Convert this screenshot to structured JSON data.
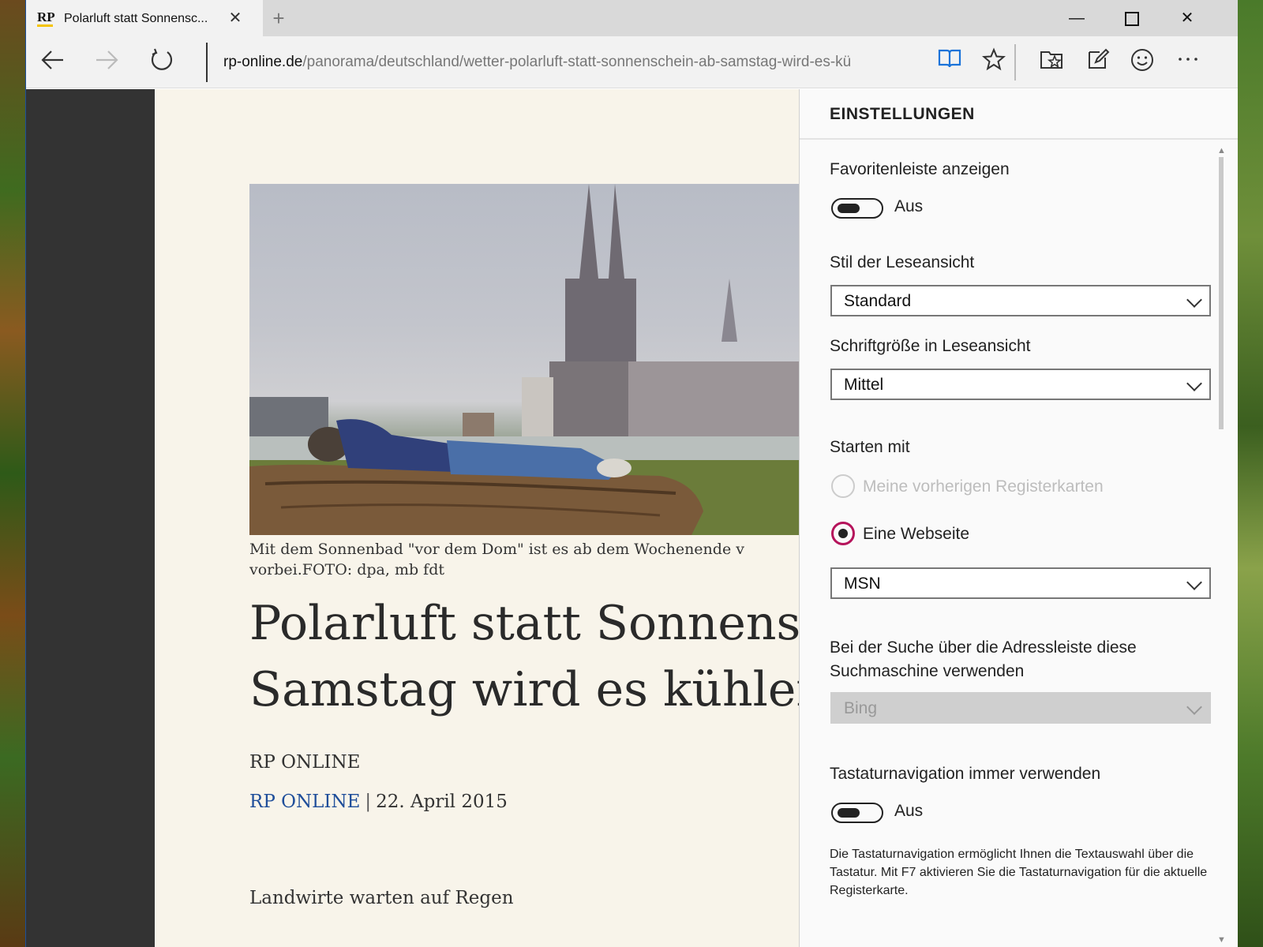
{
  "browser": {
    "tab": {
      "logo": "RP",
      "title": "Polarluft statt Sonnensc...",
      "close_glyph": "✕"
    },
    "new_tab_glyph": "+",
    "window_controls": {
      "minimize": "—",
      "close": "✕"
    },
    "address": {
      "host": "rp-online.de",
      "path": "/panorama/deutschland/wetter-polarluft-statt-sonnenschein-ab-samstag-wird-es-kü"
    },
    "icons": {
      "back": "back-arrow-icon",
      "forward": "forward-arrow-icon",
      "refresh": "refresh-icon",
      "reading_view": "reading-view-icon",
      "favorite": "star-icon",
      "hub": "hub-icon",
      "web_note": "web-note-icon",
      "feedback": "smiley-icon",
      "more": "more-icon"
    },
    "accent_color": "#1a73d9"
  },
  "article": {
    "caption": "Mit dem Sonnenbad \"vor dem Dom\" ist es ab dem Wochenende v",
    "caption_line2": "vorbei.FOTO: dpa, mb fdt",
    "headline_line1": "Polarluft statt Sonnensch",
    "headline_line2": "Samstag wird es kühler",
    "source": "RP ONLINE",
    "byline_link": "RP ONLINE",
    "byline_sep": "|",
    "date": "22. April 2015",
    "subhead": "Landwirte warten auf Regen"
  },
  "settings": {
    "title": "EINSTELLUNGEN",
    "favorites_bar": {
      "label": "Favoritenleiste anzeigen",
      "state": "Aus"
    },
    "reading_style": {
      "label": "Stil der Leseansicht",
      "value": "Standard"
    },
    "reading_font_size": {
      "label": "Schriftgröße in Leseansicht",
      "value": "Mittel"
    },
    "start_with": {
      "label": "Starten mit",
      "option_previous": "Meine vorherigen Registerkarten",
      "option_page": "Eine Webseite",
      "page_value": "MSN"
    },
    "search_engine": {
      "label_line1": "Bei der Suche über die Adressleiste diese",
      "label_line2": "Suchmaschine verwenden",
      "value": "Bing"
    },
    "caret_browsing": {
      "label": "Tastaturnavigation immer verwenden",
      "state": "Aus",
      "description": "Die Tastaturnavigation ermöglicht Ihnen die Textauswahl über die Tastatur. Mit F7 aktivieren Sie die Tastaturnavigation für die aktuelle Registerkarte."
    },
    "selected_radio_color": "#b5135b"
  }
}
